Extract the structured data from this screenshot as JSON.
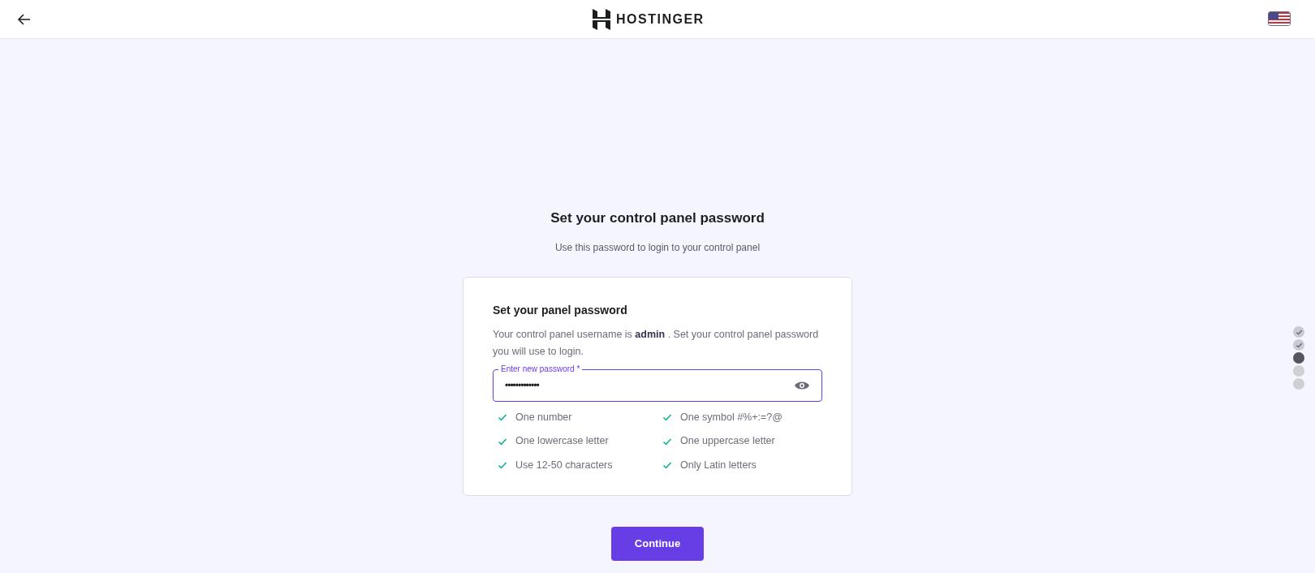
{
  "header": {
    "logo_text": "HOSTINGER"
  },
  "heading": {
    "title": "Set your control panel password",
    "subtitle": "Use this password to login to your control panel"
  },
  "card": {
    "title": "Set your panel password",
    "description": "Your control panel username is **admin** . Set your control panel password you will use to login.",
    "password_field": {
      "label": "Enter new password *",
      "value": "•••••••••••••",
      "focused": true
    },
    "requirements": [
      {
        "text": "One number",
        "met": true
      },
      {
        "text": "One symbol #%+:=?@",
        "met": true
      },
      {
        "text": "One lowercase letter",
        "met": true
      },
      {
        "text": "One uppercase letter",
        "met": true
      },
      {
        "text": "Use 12-50 characters",
        "met": true
      },
      {
        "text": "Only Latin letters",
        "met": true
      }
    ]
  },
  "continue_button": {
    "label": "Continue"
  },
  "steps": [
    {
      "kind": "done"
    },
    {
      "kind": "done"
    },
    {
      "kind": "current"
    },
    {
      "kind": "pending"
    },
    {
      "kind": "pending"
    }
  ]
}
